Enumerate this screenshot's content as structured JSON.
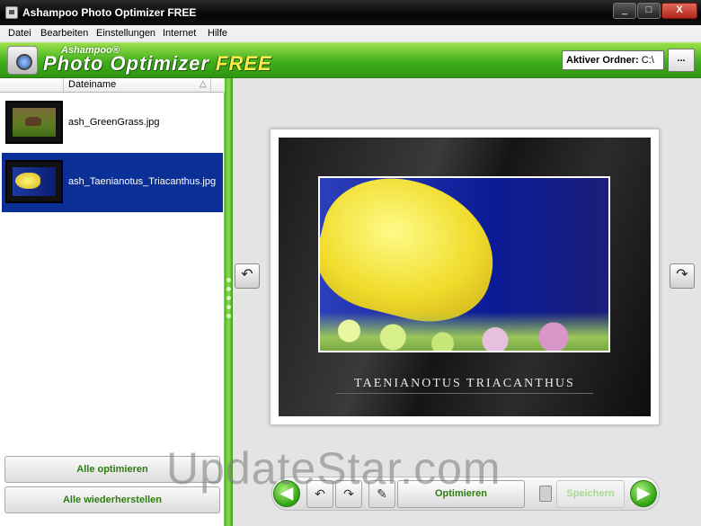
{
  "window": {
    "title": "Ashampoo Photo Optimizer FREE",
    "min_glyph": "_",
    "max_glyph": "□",
    "close_glyph": "X"
  },
  "menu": [
    "Datei",
    "Bearbeiten",
    "Einstellungen",
    "Internet",
    "Hilfe"
  ],
  "banner": {
    "brand_small": "Ashampoo®",
    "brand_main": "Photo Optimizer",
    "brand_free": "FREE",
    "folder_label": "Aktiver Ordner:",
    "folder_value": "C:\\",
    "browse_label": "..."
  },
  "file_list": {
    "column_header": "Dateiname",
    "sort_glyph": "△",
    "items": [
      {
        "name": "ash_GreenGrass.jpg",
        "selected": false
      },
      {
        "name": "ash_Taenianotus_Triacanthus.jpg",
        "selected": true
      }
    ]
  },
  "left_buttons": {
    "optimize_all": "Alle optimieren",
    "restore_all": "Alle wiederherstellen"
  },
  "preview": {
    "caption": "TAENIANOTUS TRIACANTHUS",
    "rotate_left_glyph": "↶",
    "rotate_right_glyph": "↷"
  },
  "toolbar": {
    "prev_glyph": "◀",
    "next_glyph": "▶",
    "rot_left_glyph": "↶",
    "rot_right_glyph": "↷",
    "optimize_label": "Optimieren",
    "save_label": "Speichern"
  },
  "watermark": "UpdateStar.com"
}
